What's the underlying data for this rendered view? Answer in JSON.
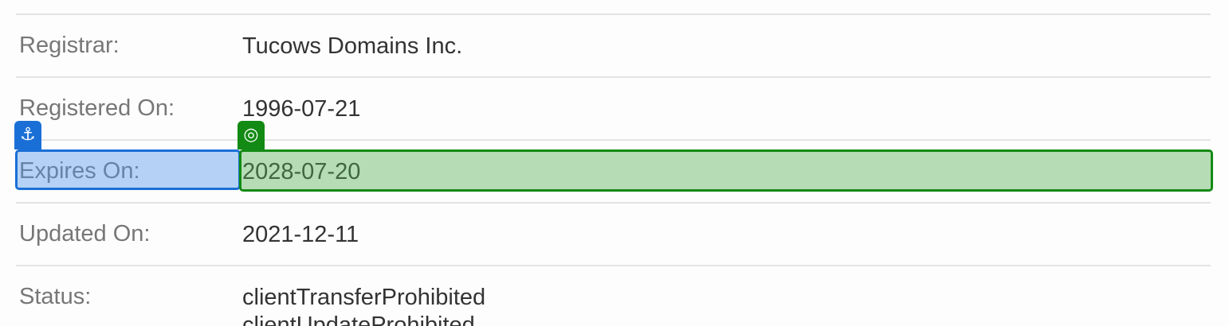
{
  "rows": [
    {
      "label": "Registrar:",
      "value": "Tucows Domains Inc."
    },
    {
      "label": "Registered On:",
      "value": "1996-07-21"
    },
    {
      "label": "Expires On:",
      "value": "2028-07-20"
    },
    {
      "label": "Updated On:",
      "value": "2021-12-11"
    },
    {
      "label": "Status:",
      "values": [
        "clientTransferProhibited",
        "clientUpdateProhibited"
      ]
    }
  ],
  "annotations": {
    "anchor": {
      "icon": "anchor-icon",
      "glyph": "⚓",
      "color": "#1a6fd6"
    },
    "target": {
      "icon": "target-icon",
      "glyph": "◎",
      "color": "#138a13"
    }
  }
}
